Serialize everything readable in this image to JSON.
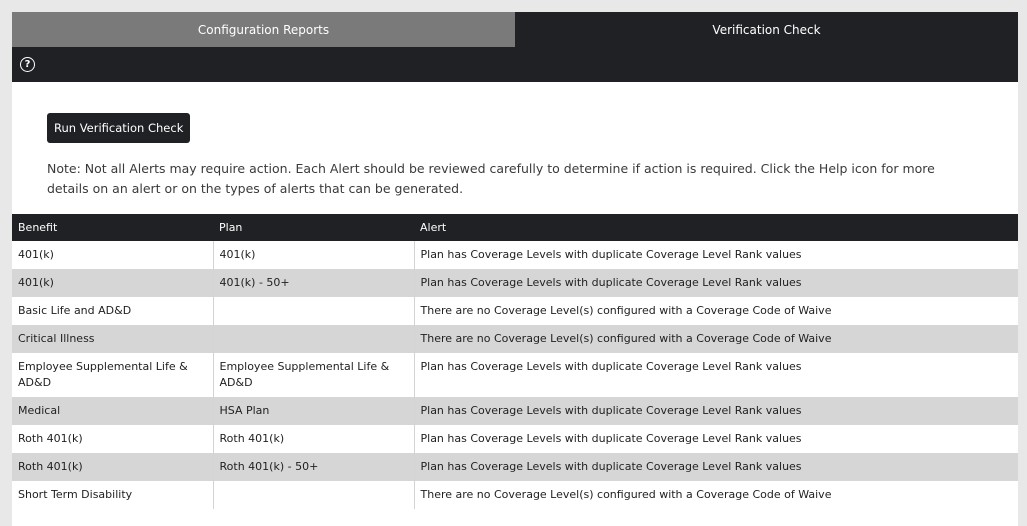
{
  "tabs": [
    {
      "label": "Configuration Reports",
      "active": false
    },
    {
      "label": "Verification Check",
      "active": true
    }
  ],
  "help_icon": {
    "glyph": "?"
  },
  "run_button": {
    "label": "Run Verification Check"
  },
  "note": "Note: Not all Alerts may require action. Each Alert should be reviewed carefully to determine if action is required. Click the Help icon for more details on an alert or on the types of alerts that can be generated.",
  "table": {
    "headers": [
      "Benefit",
      "Plan",
      "Alert"
    ],
    "rows": [
      {
        "benefit": "401(k)",
        "plan": "401(k)",
        "alert": "Plan has Coverage Levels with duplicate Coverage Level Rank values"
      },
      {
        "benefit": "401(k)",
        "plan": "401(k) - 50+",
        "alert": "Plan has Coverage Levels with duplicate Coverage Level Rank values"
      },
      {
        "benefit": "Basic Life and AD&D",
        "plan": "",
        "alert": "There are no Coverage Level(s) configured with a Coverage Code of Waive"
      },
      {
        "benefit": "Critical Illness",
        "plan": "",
        "alert": "There are no Coverage Level(s) configured with a Coverage Code of Waive"
      },
      {
        "benefit": "Employee Supplemental Life & AD&D",
        "plan": "Employee Supplemental Life & AD&D",
        "alert": "Plan has Coverage Levels with duplicate Coverage Level Rank values"
      },
      {
        "benefit": "Medical",
        "plan": "HSA Plan",
        "alert": "Plan has Coverage Levels with duplicate Coverage Level Rank values"
      },
      {
        "benefit": "Roth 401(k)",
        "plan": "Roth 401(k)",
        "alert": "Plan has Coverage Levels with duplicate Coverage Level Rank values"
      },
      {
        "benefit": "Roth 401(k)",
        "plan": "Roth 401(k) - 50+",
        "alert": "Plan has Coverage Levels with duplicate Coverage Level Rank values"
      },
      {
        "benefit": "Short Term Disability",
        "plan": "",
        "alert": "There are no Coverage Level(s) configured with a Coverage Code of Waive"
      }
    ]
  },
  "colors": {
    "dark": "#1f2124",
    "inactive_tab": "#7a7a7a",
    "row_alt": "#d6d6d6"
  }
}
